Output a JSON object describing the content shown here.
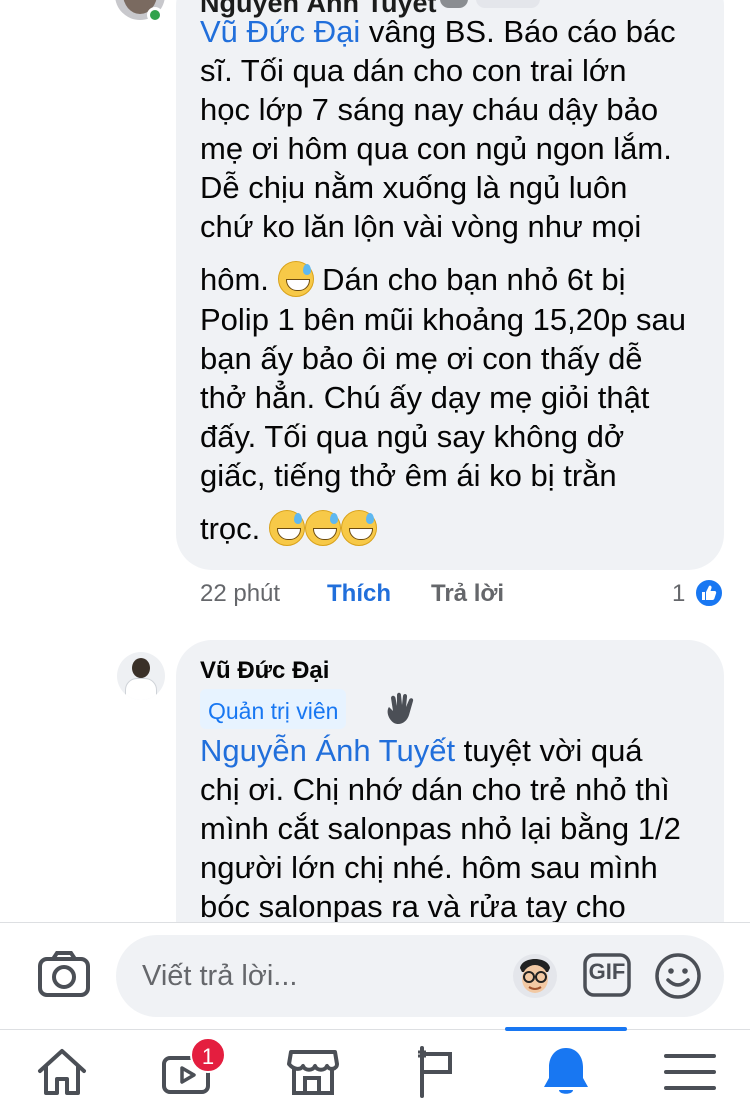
{
  "top_comment": {
    "author_cut": "Nguyễn Ánh Tuyết",
    "mention": "Vũ Đức Đại",
    "lines": [
      " vâng BS. Báo cáo bác",
      "sĩ. Tối qua dán cho con trai lớn",
      "học lớp 7 sáng nay cháu dậy bảo",
      "mẹ ơi hôm qua con ngủ ngon lắm.",
      "Dễ chịu nằm xuống là ngủ luôn",
      "chứ ko lăn lộn vài vòng như mọi"
    ],
    "line7_a": "hôm. ",
    "line7_b": " Dán cho bạn nhỏ 6t  bị",
    "lines_after": [
      "Polip 1 bên mũi khoảng 15,20p sau",
      "bạn ấy bảo ôi mẹ ơi con thấy dễ",
      "thở hẳn. Chú ấy dạy mẹ giỏi thật",
      "đấy. Tối qua ngủ say không dở",
      "giấc, tiếng thở êm ái ko bị trằn"
    ],
    "last_line": "trọc. ",
    "time": "22 phút",
    "like_label": "Thích",
    "reply_label": "Trả lời",
    "reaction_count": "1",
    "emoji_name": "grinning-sweat-emoji"
  },
  "second_comment": {
    "author": "Vũ Đức Đại",
    "badge": "Quản trị viên",
    "mention": "Nguyễn Ánh Tuyết",
    "first_line_rest": " tuyệt vời quá",
    "lines": [
      "chị ơi. Chị nhớ dán cho trẻ nhỏ thì",
      "mình cắt salonpas nhỏ lại bằng 1/2",
      "người lớn chị nhé. hôm sau mình",
      "bóc salonpas ra và rửa tay cho"
    ]
  },
  "composer": {
    "placeholder": "Viết trả lời...",
    "gif_label": "GIF"
  },
  "bottom_nav": {
    "items": [
      "home-icon",
      "watch-icon",
      "marketplace-icon",
      "pages-icon",
      "notifications-icon",
      "menu-icon"
    ],
    "active": "notifications-icon",
    "watch_badge": "1"
  },
  "colors": {
    "accent": "#1877f2",
    "mention": "#216fdb",
    "bubble": "#f0f2f5",
    "secondary_text": "#65676b",
    "badge_red": "#e41e3f",
    "online_green": "#31a24c"
  }
}
